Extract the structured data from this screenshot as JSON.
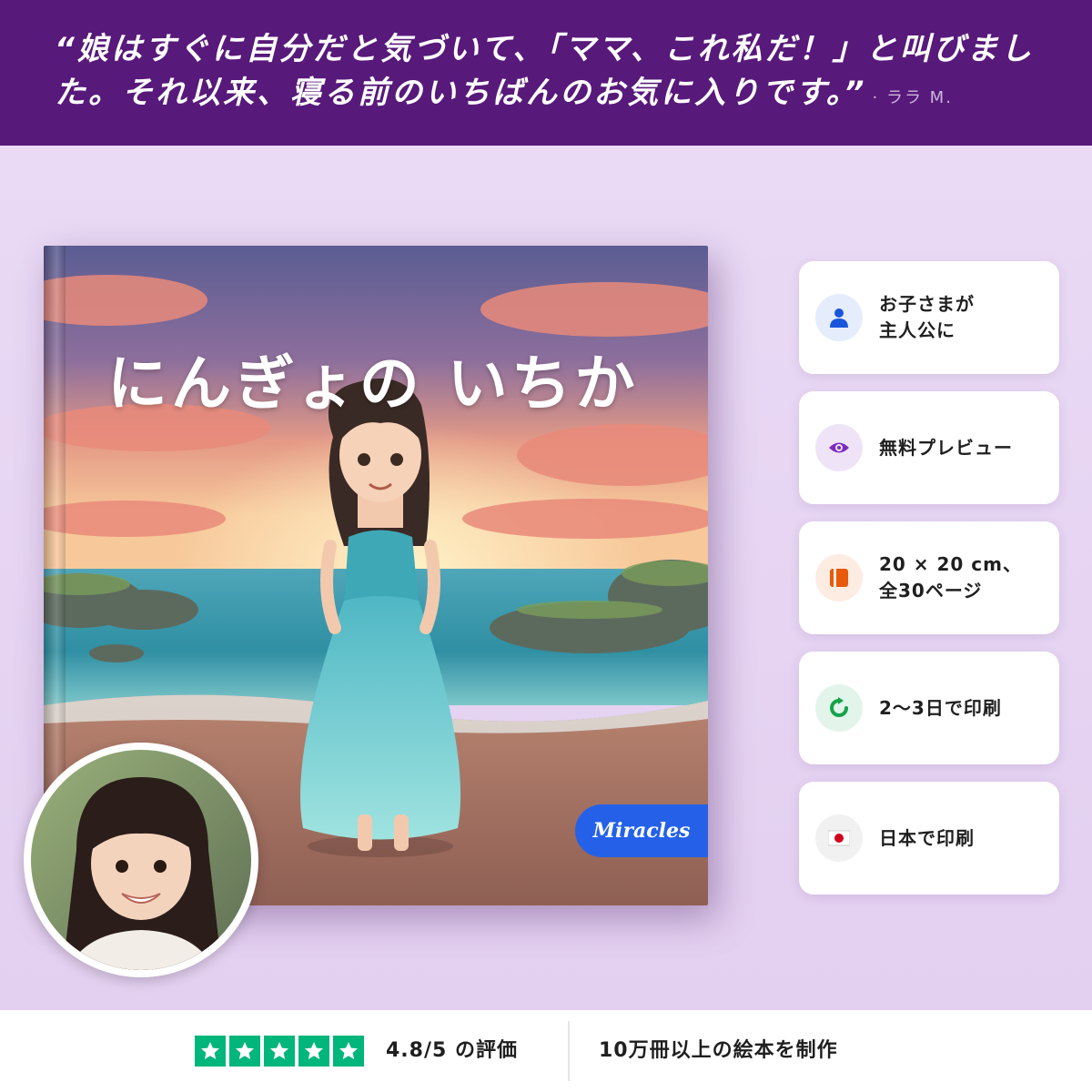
{
  "banner": {
    "quote": "“娘はすぐに自分だと気づいて、「ママ、これ私だ！」と叫びました。それ以来、寝る前のいちばんのお気に入りです。”",
    "author": "· ララ M."
  },
  "book": {
    "title": "にんぎょの いちか",
    "brand": "Miracles"
  },
  "features": [
    {
      "icon": "person-icon",
      "label": "お子さまが\n主人公に",
      "color": "#1a56db",
      "bg": "#e5ecfb"
    },
    {
      "icon": "eye-icon",
      "label": "無料プレビュー",
      "color": "#7b2cbf",
      "bg": "#efe4f7"
    },
    {
      "icon": "book-icon",
      "label": "20 × 20 cm、\n全30ページ",
      "color": "#e8590c",
      "bg": "#fdece2"
    },
    {
      "icon": "refresh-icon",
      "label": "2〜3日で印刷",
      "color": "#16a34a",
      "bg": "#e3f5ea"
    },
    {
      "icon": "japan-flag-icon",
      "label": "日本で印刷",
      "color": "#d0021b",
      "bg": "#f1f1f1"
    }
  ],
  "reviews": {
    "stars": 5,
    "rating_text": "4.8/5 の評価",
    "star_color": "#00b67a"
  },
  "stats": {
    "books_made": "10万冊以上の絵本を制作"
  }
}
